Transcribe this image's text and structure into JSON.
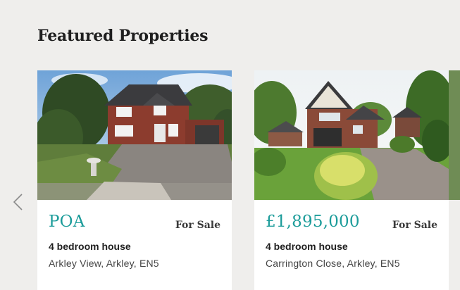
{
  "section": {
    "title": "Featured Properties"
  },
  "nav": {
    "prev_icon": "chevron-left-icon"
  },
  "listings": [
    {
      "price": "POA",
      "status": "For Sale",
      "type": "4 bedroom house",
      "address": "Arkley View, Arkley, EN5"
    },
    {
      "price": "£1,895,000",
      "status": "For Sale",
      "type": "4 bedroom house",
      "address": "Carrington Close, Arkley, EN5"
    }
  ]
}
